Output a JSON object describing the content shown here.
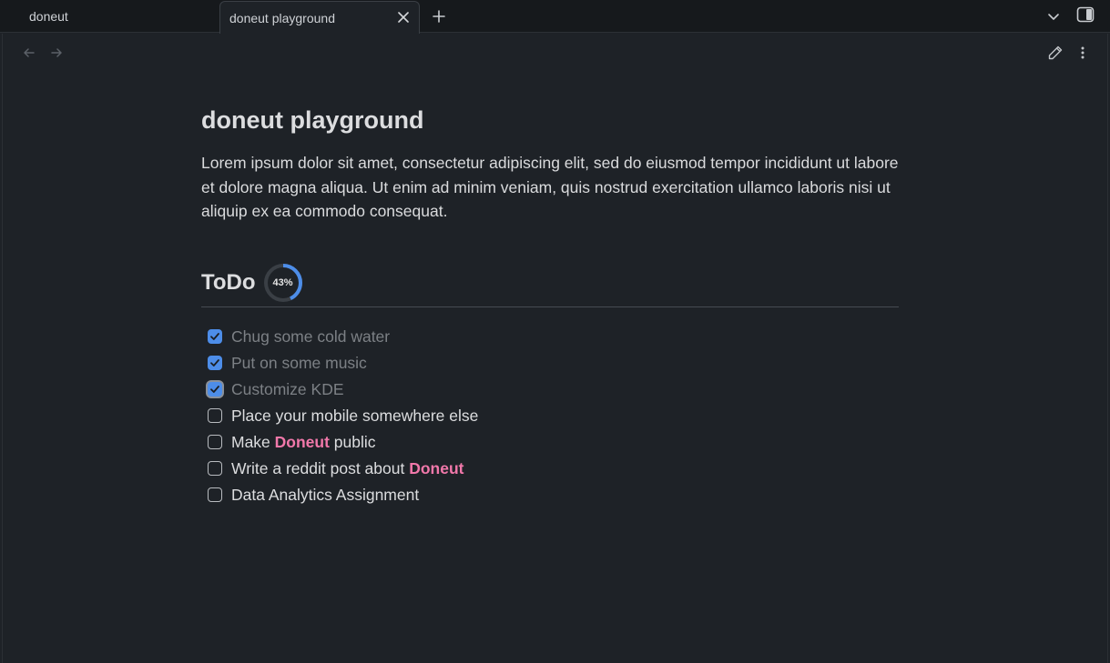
{
  "tabs": [
    {
      "label": "doneut",
      "active": false
    },
    {
      "label": "doneut playground",
      "active": true
    }
  ],
  "note": {
    "title": "doneut playground",
    "paragraph": "Lorem ipsum dolor sit amet, consectetur adipiscing elit, sed do eiusmod tempor incididunt ut labore et dolore magna aliqua. Ut enim ad minim veniam, quis nostrud exercitation ullamco laboris nisi ut aliquip ex ea commodo consequat."
  },
  "todo": {
    "heading": "ToDo",
    "progress_label": "43%",
    "progress_fraction": 0.43,
    "tasks": [
      {
        "text": "Chug some cold water",
        "checked": true
      },
      {
        "text": "Put on some music",
        "checked": true
      },
      {
        "text": "Customize KDE",
        "checked": true
      },
      {
        "text": "Place your mobile somewhere else",
        "checked": false
      },
      {
        "text_before": "Make ",
        "highlight": "Doneut",
        "text_after": " public",
        "checked": false
      },
      {
        "text_before": "Write a reddit post about ",
        "highlight": "Doneut",
        "text_after": "",
        "checked": false
      },
      {
        "text": "Data Analytics Assignment",
        "checked": false
      }
    ]
  },
  "colors": {
    "accent": "#4d8de8",
    "highlight": "#f178aa",
    "ring_track": "#3a3f45"
  },
  "icons": [
    "close-icon",
    "plus-icon",
    "chevron-down-icon",
    "sidebar-toggle-icon",
    "arrow-left-icon",
    "arrow-right-icon",
    "pencil-icon",
    "more-vertical-icon",
    "check-icon"
  ]
}
